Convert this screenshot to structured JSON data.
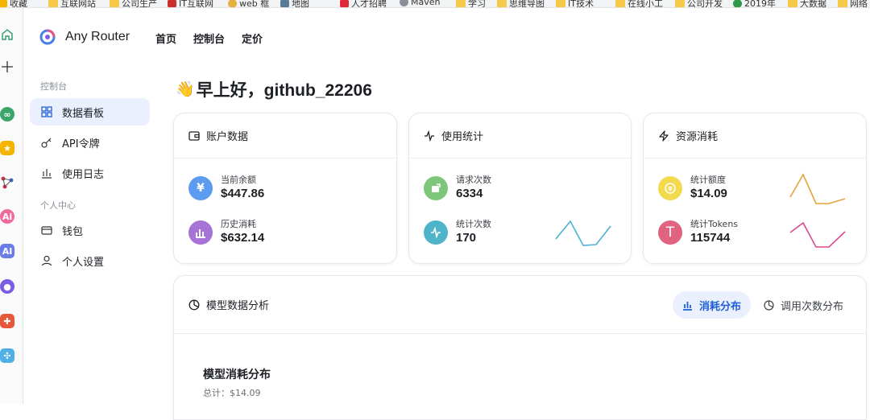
{
  "bookmarks": [
    "收藏",
    "互联网站",
    "公司生产",
    "IT互联网",
    "web 框",
    "地图",
    "人才招聘",
    "Maven",
    "学习",
    "思维导图",
    "IT技术",
    "在线小工",
    "公司开发",
    "2019年",
    "大数据",
    "网络"
  ],
  "brand": {
    "name": "Any Router"
  },
  "nav": {
    "home": "首页",
    "console": "控制台",
    "pricing": "定价"
  },
  "sidebar": {
    "section_console": "控制台",
    "section_personal": "个人中心",
    "items": [
      {
        "label": "数据看板",
        "icon": "dashboard-icon",
        "active": true
      },
      {
        "label": "API令牌",
        "icon": "key-icon",
        "active": false
      },
      {
        "label": "使用日志",
        "icon": "chart-icon",
        "active": false
      },
      {
        "label": "钱包",
        "icon": "wallet-icon",
        "active": false
      },
      {
        "label": "个人设置",
        "icon": "user-icon",
        "active": false
      }
    ]
  },
  "greeting": {
    "emoji": "👋",
    "text": "早上好，github_22206"
  },
  "cards": {
    "account": {
      "title": "账户数据",
      "balance_label": "当前余额",
      "balance_value": "$447.86",
      "spent_label": "历史消耗",
      "spent_value": "$632.14"
    },
    "usage": {
      "title": "使用统计",
      "requests_label": "请求次数",
      "requests_value": "6334",
      "stat_label": "统计次数",
      "stat_value": "170"
    },
    "resource": {
      "title": "资源消耗",
      "quota_label": "统计额度",
      "quota_value": "$14.09",
      "tokens_label": "统计Tokens",
      "tokens_value": "115744"
    }
  },
  "analysis": {
    "title": "模型数据分析",
    "tab_consumption": "消耗分布",
    "tab_calls": "调用次数分布",
    "chart_title": "模型消耗分布",
    "chart_total": "总计：$14.09"
  },
  "colors": {
    "accent": "#1f5fd6",
    "blue": "#5b9bf0",
    "purple": "#a873d6",
    "green": "#7ec77a",
    "teal": "#4fb4c9",
    "yellow": "#f2d94e",
    "pink": "#e0637f",
    "spark_blue": "#47b3d6",
    "spark_orange": "#e6a23c",
    "spark_pink": "#d94c8f"
  }
}
